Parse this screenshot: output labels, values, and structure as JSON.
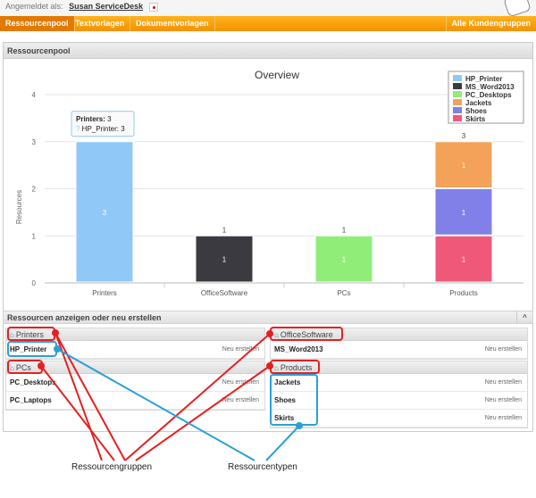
{
  "header": {
    "logged_in_label": "Angemeldet als:",
    "user_name": "Susan ServiceDesk"
  },
  "nav": {
    "tabs": [
      "Ressourcenpool",
      "Textvorlagen",
      "Dokumentvorlagen"
    ],
    "right_tab": "Alle Kundengruppen"
  },
  "panel": {
    "title": "Ressourcenpool"
  },
  "chart_data": {
    "type": "bar",
    "title": "Overview",
    "ylabel": "Resources",
    "xlabel": "",
    "ylim": [
      0,
      4
    ],
    "yticks": [
      0,
      1,
      2,
      3,
      4
    ],
    "categories": [
      "Printers",
      "OfficeSoftware",
      "PCs",
      "Products"
    ],
    "stacked": true,
    "legend_position": "top-right",
    "series": [
      {
        "name": "HP_Printer",
        "color": "#90c8f8",
        "values": [
          3,
          0,
          0,
          0
        ]
      },
      {
        "name": "MS_Word2013",
        "color": "#3a3a40",
        "values": [
          0,
          1,
          0,
          0
        ]
      },
      {
        "name": "PC_Desktops",
        "color": "#90ee78",
        "values": [
          0,
          0,
          1,
          0
        ]
      },
      {
        "name": "Jackets",
        "color": "#f4a25a",
        "values": [
          0,
          0,
          0,
          0
        ]
      },
      {
        "name": "Shoes",
        "color": "#8080e8",
        "values": [
          0,
          0,
          0,
          1
        ]
      },
      {
        "name": "Skirts",
        "color": "#f0587a",
        "values": [
          0,
          0,
          0,
          1
        ]
      }
    ],
    "stack_segments": [
      {
        "category": "Printers",
        "series": "HP_Printer",
        "value": 3,
        "label": "3"
      },
      {
        "category": "OfficeSoftware",
        "series": "MS_Word2013",
        "value": 1,
        "label": "1"
      },
      {
        "category": "PCs",
        "series": "PC_Desktops",
        "value": 1,
        "label": "1"
      },
      {
        "category": "Products",
        "series": "Skirts",
        "value": 1,
        "label": "1"
      },
      {
        "category": "Products",
        "series": "Shoes",
        "value": 1,
        "label": "1"
      },
      {
        "category": "Products",
        "series": "Jackets",
        "value": 1,
        "label": "1"
      }
    ],
    "totals": [
      {
        "category": "OfficeSoftware",
        "label": "1"
      },
      {
        "category": "PCs",
        "label": "1"
      },
      {
        "category": "Products",
        "label": "3"
      }
    ],
    "tooltip": {
      "title": "Printers:",
      "value": "3",
      "marker": "?",
      "line": "HP_Printer: 3"
    }
  },
  "section": {
    "title": "Ressourcen anzeigen oder neu erstellen",
    "collapse_icon": "^"
  },
  "groups": [
    {
      "name": "Printers",
      "items": [
        {
          "type": "HP_Printer",
          "action": "Neu erstellen"
        }
      ]
    },
    {
      "name": "PCs",
      "items": [
        {
          "type": "PC_Desktops",
          "action": "Neu erstellen"
        },
        {
          "type": "PC_Laptops",
          "action": "Neu erstellen"
        }
      ]
    },
    {
      "name": "OfficeSoftware",
      "items": [
        {
          "type": "MS_Word2013",
          "action": "Neu erstellen"
        }
      ]
    },
    {
      "name": "Products",
      "items": [
        {
          "type": "Jackets",
          "action": "Neu erstellen"
        },
        {
          "type": "Shoes",
          "action": "Neu erstellen"
        },
        {
          "type": "Skirts",
          "action": "Neu erstellen"
        }
      ]
    }
  ],
  "annotations": {
    "groups_label": "Ressourcengruppen",
    "types_label": "Ressourcentypen"
  },
  "colors": {
    "accent": "#f39200",
    "callout_red": "#e52021",
    "callout_blue": "#2b9fd8"
  }
}
